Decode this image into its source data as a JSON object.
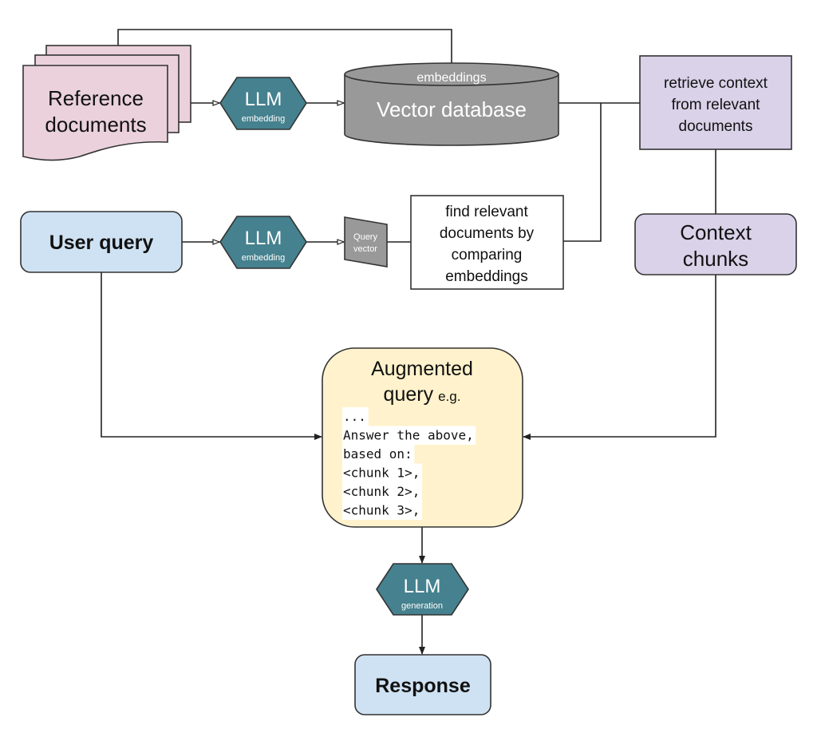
{
  "colors": {
    "reference_docs": "#ead1dc",
    "llm_hexagon": "#45818e",
    "vector_db": "#999999",
    "query_box": "#cfe2f3",
    "context_box": "#d9d2e9",
    "augmented_box": "#fff2cc"
  },
  "nodes": {
    "reference_documents": [
      "Reference",
      "documents"
    ],
    "llm_embedding_1": {
      "title": "LLM",
      "subtitle": "embedding"
    },
    "vector_database": {
      "top": "embeddings",
      "label": "Vector database"
    },
    "retrieve_context": [
      "retrieve context",
      "from relevant",
      "documents"
    ],
    "user_query": "User query",
    "llm_embedding_2": {
      "title": "LLM",
      "subtitle": "embedding"
    },
    "query_vector": [
      "Query",
      "vector"
    ],
    "find_relevant": [
      "find relevant",
      "documents by",
      "comparing",
      "embeddings"
    ],
    "context_chunks": [
      "Context",
      "chunks"
    ],
    "augmented_query": {
      "title_line1": "Augmented",
      "title_line2": "query",
      "title_suffix": "e.g.",
      "code_lines": [
        "...",
        "Answer the above,",
        "based on:",
        "<chunk 1>,",
        "<chunk 2>,",
        "<chunk 3>,"
      ]
    },
    "llm_generation": {
      "title": "LLM",
      "subtitle": "generation"
    },
    "response": "Response"
  }
}
